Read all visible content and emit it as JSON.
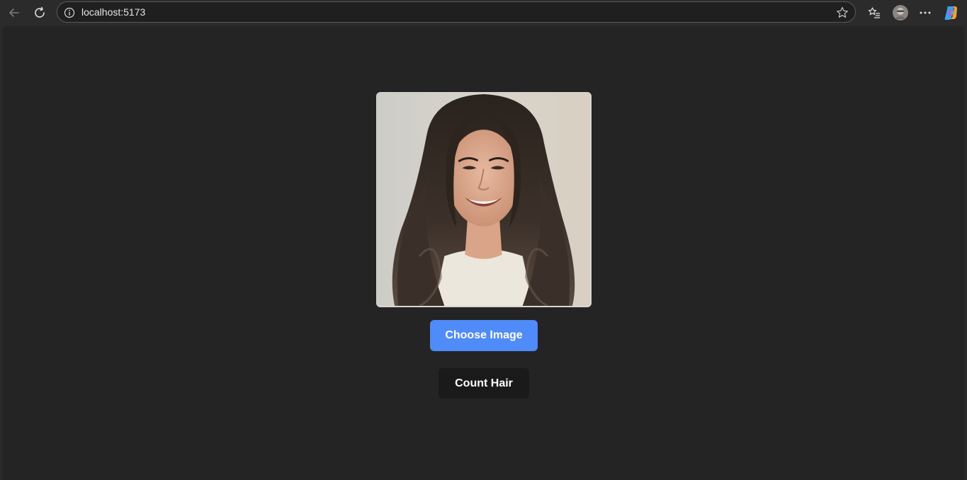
{
  "browser": {
    "url": "localhost:5173",
    "icons": [
      "back-arrow-icon",
      "reload-icon",
      "site-info-icon",
      "favorite-star-icon",
      "favorites-list-icon",
      "profile-avatar",
      "more-options-icon",
      "copilot-icon"
    ]
  },
  "main": {
    "image": {
      "description_icon": "portrait-photo"
    },
    "choose_button_label": "Choose Image",
    "count_button_label": "Count Hair"
  },
  "colors": {
    "page_background": "#242424",
    "primary_button": "#4f8bf9",
    "secondary_button": "#1a1a1a",
    "button_text": "#ffffff"
  }
}
